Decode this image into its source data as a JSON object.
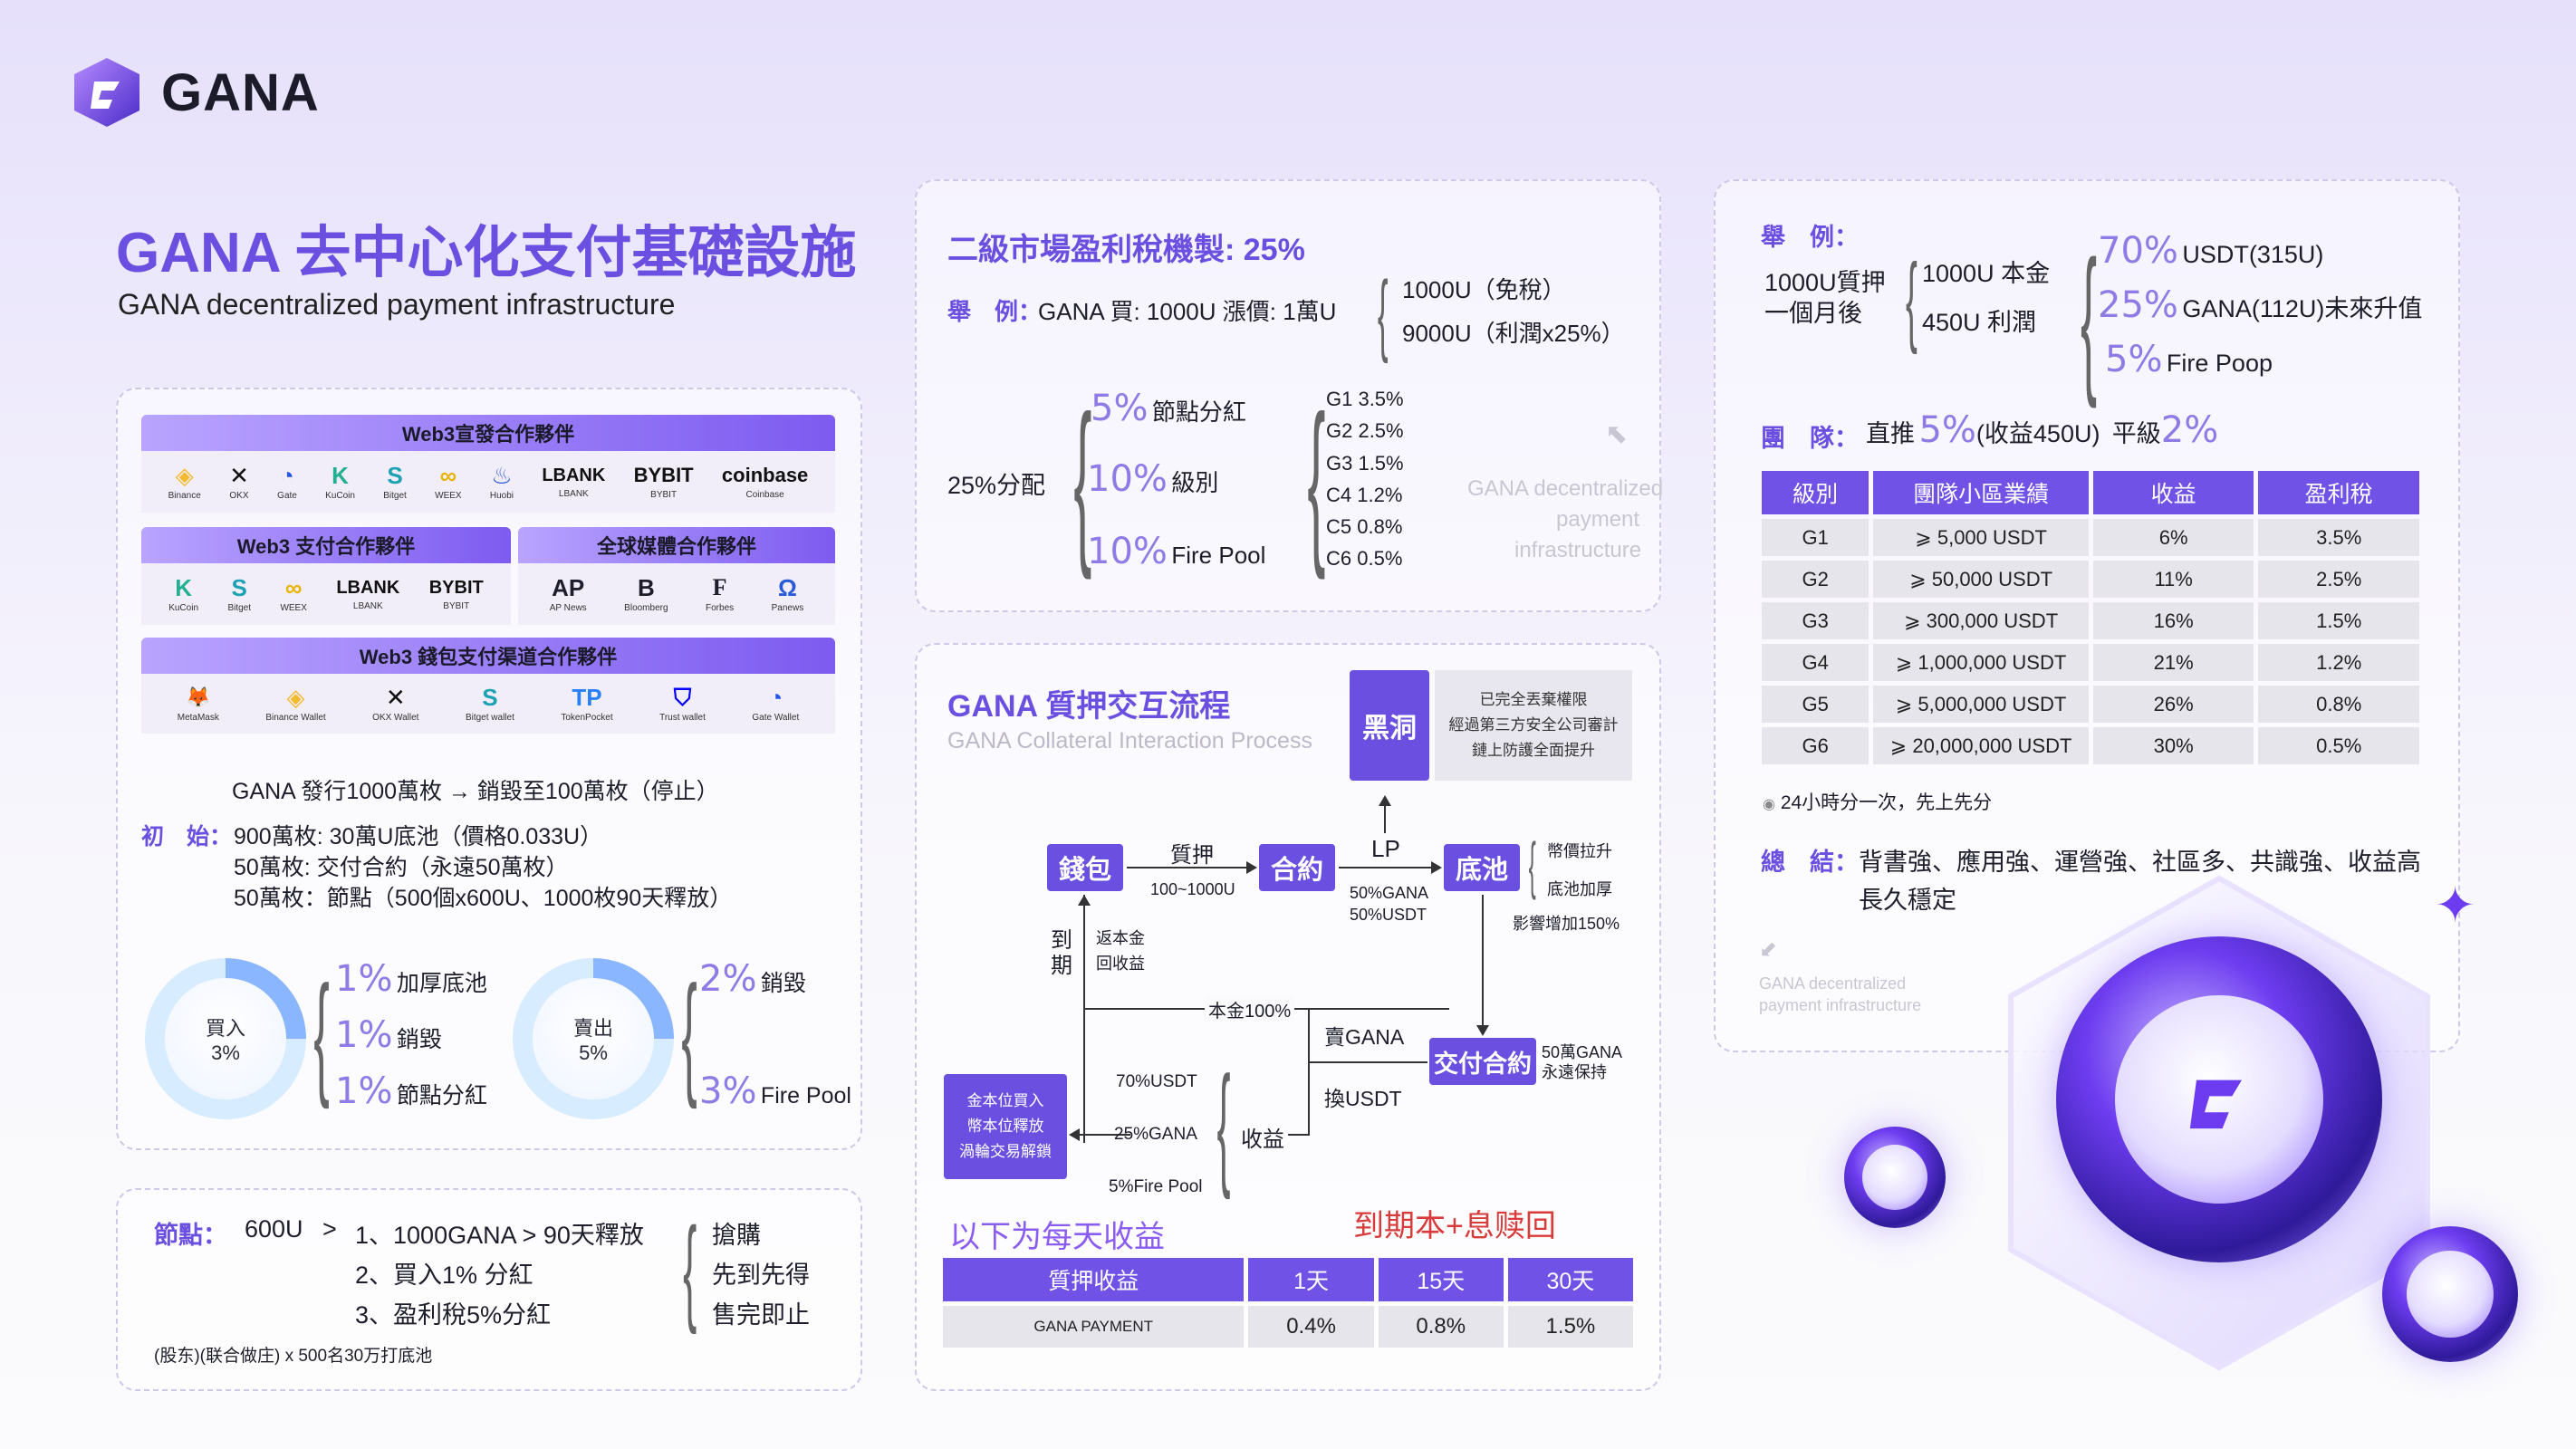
{
  "brand": {
    "name": "GANA"
  },
  "title": "GANA 去中心化支付基礎設施",
  "subtitle": "GANA decentralized payment infrastructure",
  "partners": {
    "web3_declare": {
      "header": "Web3宣發合作夥伴",
      "items": [
        {
          "icon": "binance-icon",
          "glyph": "◈",
          "name": "Binance",
          "color": "#f3ba2f"
        },
        {
          "icon": "okx-icon",
          "glyph": "✕",
          "name": "OKX",
          "color": "#111111"
        },
        {
          "icon": "gate-icon",
          "glyph": "◔",
          "name": "Gate",
          "color": "#2354e6"
        },
        {
          "icon": "kucoin-icon",
          "glyph": "K",
          "name": "KuCoin",
          "color": "#23af91"
        },
        {
          "icon": "bitget-icon",
          "glyph": "S",
          "name": "Bitget",
          "color": "#1da2b4"
        },
        {
          "icon": "weex-icon",
          "glyph": "∞",
          "name": "WEEX",
          "color": "#e8b400"
        },
        {
          "icon": "huobi-icon",
          "glyph": "♨",
          "name": "Huobi",
          "color": "#2a5ada"
        }
      ],
      "text_logos": [
        {
          "text": "LBANK",
          "name": "LBANK"
        },
        {
          "text": "BYBIT",
          "name": "BYBIT"
        },
        {
          "text": "coinbase",
          "name": "Coinbase"
        }
      ]
    },
    "web3_payment": {
      "header": "Web3 支付合作夥伴",
      "items": [
        {
          "icon": "kucoin-icon",
          "glyph": "K",
          "name": "KuCoin",
          "color": "#23af91"
        },
        {
          "icon": "bitget-icon",
          "glyph": "S",
          "name": "Bitget",
          "color": "#1da2b4"
        },
        {
          "icon": "weex-icon",
          "glyph": "∞",
          "name": "WEEX",
          "color": "#e8b400"
        }
      ],
      "text_logos": [
        {
          "text": "LBANK",
          "name": "LBANK"
        },
        {
          "text": "BYBIT",
          "name": "BYBIT"
        }
      ]
    },
    "global_media": {
      "header": "全球媒體合作夥伴",
      "items": [
        {
          "glyph": "AP",
          "name": "AP News"
        },
        {
          "glyph": "B",
          "name": "Bloomberg"
        },
        {
          "glyph": "F",
          "name": "Forbes"
        },
        {
          "glyph": "Ω",
          "name": "Panews"
        }
      ]
    },
    "wallet_payment": {
      "header": "Web3 錢包支付渠道合作夥伴",
      "items": [
        {
          "icon": "metamask-icon",
          "glyph": "🦊",
          "name": "MetaMask",
          "color": "#e2761b"
        },
        {
          "icon": "binance-wallet-icon",
          "glyph": "◈",
          "name": "Binance Wallet",
          "color": "#f3ba2f"
        },
        {
          "icon": "okx-wallet-icon",
          "glyph": "✕",
          "name": "OKX Wallet",
          "color": "#111111"
        },
        {
          "icon": "bitget-wallet-icon",
          "glyph": "S",
          "name": "Bitget wallet",
          "color": "#1da2b4"
        },
        {
          "icon": "tokenpocket-icon",
          "glyph": "TP",
          "name": "TokenPocket",
          "color": "#2980fe"
        },
        {
          "icon": "trust-wallet-icon",
          "glyph": "⛉",
          "name": "Trust wallet",
          "color": "#0500ff"
        },
        {
          "icon": "gate-wallet-icon",
          "glyph": "◔",
          "name": "Gate Wallet",
          "color": "#2354e6"
        }
      ]
    }
  },
  "issuance": {
    "line1": "GANA 發行1000萬枚 → 銷毀至100萬枚（停止）",
    "init_label": "初　始：",
    "init_items": [
      "900萬枚: 30萬U底池（價格0.033U）",
      "50萬枚: 交付合約（永遠50萬枚）",
      "50萬枚：節點（500個x600U、1000枚90天釋放）"
    ]
  },
  "buy_tax": {
    "label": "買入",
    "value": "3%",
    "items": [
      {
        "pct": "1%",
        "text": "加厚底池"
      },
      {
        "pct": "1%",
        "text": "銷毀"
      },
      {
        "pct": "1%",
        "text": "節點分紅"
      }
    ]
  },
  "sell_tax": {
    "label": "賣出",
    "value": "5%",
    "items": [
      {
        "pct": "2%",
        "text": "銷毀"
      },
      {
        "pct": "3%",
        "text": "Fire Pool"
      }
    ]
  },
  "node": {
    "label": "節點：",
    "price": "600U",
    "gt": ">",
    "items": [
      "1、1000GANA > 90天釋放",
      "2、買入1% 分紅",
      "3、盈利稅5%分紅"
    ],
    "right": [
      "搶購",
      "先到先得",
      "售完即止"
    ],
    "footnote": "(股东)(联合做庄) x 500名30万打底池"
  },
  "secondary": {
    "title": "二級市場盈利稅機製: 25%",
    "example_label": "舉　例：",
    "example_text": "GANA 買: 1000U 漲價: 1萬U",
    "example_out": [
      "1000U（免稅）",
      "9000U（利潤x25%）"
    ],
    "dist_label": "25%分配",
    "dist_items": [
      {
        "pct": "5%",
        "text": "節點分紅"
      },
      {
        "pct": "10%",
        "text": "級別"
      },
      {
        "pct": "10%",
        "text": "Fire Pool"
      }
    ],
    "levels": [
      "G1  3.5%",
      "G2  2.5%",
      "G3  1.5%",
      "C4  1.2%",
      "C5  0.8%",
      "C6  0.5%"
    ],
    "watermark": [
      "GANA decentralized",
      "payment",
      "infrastructure"
    ]
  },
  "flow": {
    "title": "GANA 質押交互流程",
    "subtitle": "GANA Collateral Interaction Process",
    "nodes": {
      "wallet": "錢包",
      "contract": "合約",
      "pool": "底池",
      "blackhole": "黑洞",
      "delivery": "交付合約"
    },
    "blackhole_note": [
      "已完全丟棄權限",
      "經過第三方安全公司審計",
      "鏈上防護全面提升"
    ],
    "stake": "質押",
    "stake_range": "100~1000U",
    "lp": "LP",
    "lp_split": [
      "50%GANA",
      "50%USDT"
    ],
    "pool_notes": [
      "幣價拉升",
      "底池加厚",
      "影響增加150%"
    ],
    "expire": [
      "到",
      "期"
    ],
    "expire_note": [
      "返本金",
      "回收益"
    ],
    "principal": "本金100%",
    "sell_gana": "賣GANA",
    "swap_usdt": "換USDT",
    "delivery_note": [
      "50萬GANA",
      "永遠保持"
    ],
    "gold_box": [
      "金本位買入",
      "幣本位釋放",
      "渦輪交易解鎖"
    ],
    "profit_split": [
      "70%USDT",
      "25%GANA",
      "5%Fire Pool"
    ],
    "profit_label": "收益"
  },
  "daily": {
    "left_title": "以下为每天收益",
    "right_title": "到期本+息赎回",
    "headers": [
      "質押收益",
      "1天",
      "15天",
      "30天"
    ],
    "row": [
      "GANA PAYMENT",
      "0.4%",
      "0.8%",
      "1.5%"
    ]
  },
  "example2": {
    "label": "舉　例：",
    "left": [
      "1000U質押",
      "一個月後"
    ],
    "mid": [
      "1000U 本金",
      "450U 利潤"
    ],
    "right": [
      {
        "pct": "70%",
        "text": "USDT(315U)"
      },
      {
        "pct": "25%",
        "text": "GANA(112U)未來升值"
      },
      {
        "pct": "5%",
        "text": "Fire Poop"
      }
    ]
  },
  "team": {
    "label": "團　隊：",
    "direct": "直推",
    "direct_pct": "5%",
    "direct_note": "(收益450U)",
    "flat": "平級",
    "flat_pct": "2%",
    "headers": [
      "級別",
      "團隊小區業績",
      "收益",
      "盈利稅"
    ],
    "rows": [
      [
        "G1",
        "⩾ 5,000 USDT",
        "6%",
        "3.5%"
      ],
      [
        "G2",
        "⩾ 50,000 USDT",
        "11%",
        "2.5%"
      ],
      [
        "G3",
        "⩾ 300,000 USDT",
        "16%",
        "1.5%"
      ],
      [
        "G4",
        "⩾ 1,000,000 USDT",
        "21%",
        "1.2%"
      ],
      [
        "G5",
        "⩾ 5,000,000 USDT",
        "26%",
        "0.8%"
      ],
      [
        "G6",
        "⩾ 20,000,000 USDT",
        "30%",
        "0.5%"
      ]
    ],
    "note": "24小時分一次，先上先分"
  },
  "summary": {
    "label": "總　結：",
    "text1": "背書強、應用強、運營強、社區多、共識強、收益高",
    "text2": "長久穩定",
    "watermark": [
      "GANA decentralized",
      "payment infrastructure"
    ]
  },
  "colors": {
    "accent": "#6b4fe0",
    "header": "#7152e6",
    "red": "#d93a3a"
  }
}
